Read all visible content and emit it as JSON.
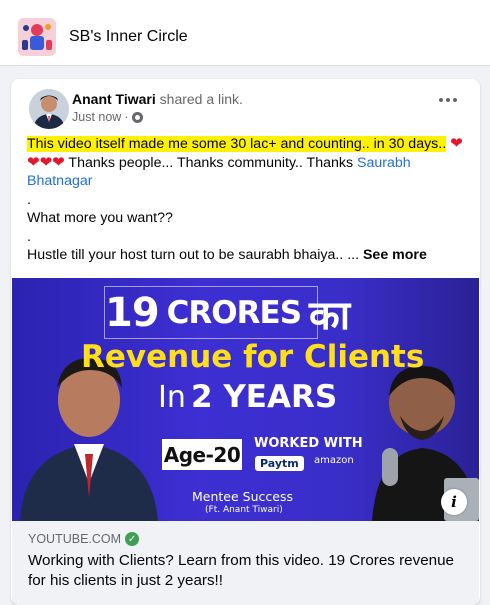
{
  "group": {
    "name": "SB's Inner Circle"
  },
  "post": {
    "author": "Anant Tiwari",
    "action": "shared a link.",
    "timestamp": "Just now",
    "privacy_icon": "globe-icon",
    "text": {
      "highlight": "This video itself made me some 30 lac+ and counting.. in 30 days..",
      "thanks": "Thanks people... Thanks community.. Thanks",
      "mention": "Saurabh Bhatnagar",
      "dot": ".",
      "question": "What more you want??",
      "hustle": "Hustle till your host turn out to be saurabh bhaiya.. ...",
      "see_more": "See more"
    },
    "link": {
      "domain": "YOUTUBE.COM",
      "title": "Working with Clients? Learn from this video. 19 Crores revenue for his clients in just 2 years!!"
    },
    "thumbnail": {
      "num": "19",
      "crores": "CRORES",
      "ka": "का",
      "line2": "Revenue for Clients",
      "in": "In",
      "years": "2 YEARS",
      "age": "Age-20",
      "worked_with": "WORKED WITH",
      "paytm": "Paytm",
      "amazon": "amazon",
      "mentee": "Mentee Success",
      "ft": "(Ft. Anant Tiwari)"
    }
  },
  "colors": {
    "highlight": "#fff200",
    "mention": "#216fdb",
    "thumbnail_bg": "#3a2ec9",
    "thumbnail_accent": "#ffde1a"
  }
}
